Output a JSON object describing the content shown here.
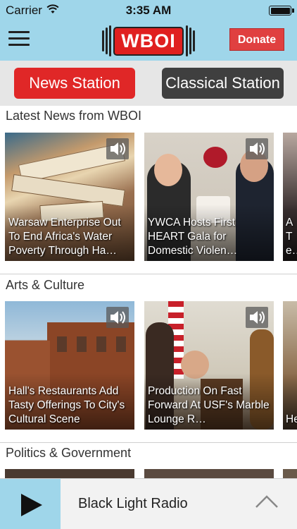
{
  "status": {
    "carrier": "Carrier",
    "time": "3:35 AM"
  },
  "header": {
    "logo_text": "WBOI",
    "donate_label": "Donate"
  },
  "stations": {
    "news_label": "News Station",
    "classical_label": "Classical Station"
  },
  "sections": [
    {
      "title": "Latest News from WBOI",
      "cards": [
        {
          "title": "Warsaw Enterprise Out To End Africa's Water Poverty Through Ha…"
        },
        {
          "title": "YWCA Hosts First HEART Gala for Domestic Violen…"
        },
        {
          "title": "A Te Sc"
        }
      ]
    },
    {
      "title": "Arts & Culture",
      "cards": [
        {
          "title": "Hall's Restaurants Add Tasty Offerings To City's Cultural Scene"
        },
        {
          "title": "Production On Fast Forward At USF's Marble Lounge R…"
        },
        {
          "title": "He"
        }
      ]
    },
    {
      "title": "Politics & Government"
    }
  ],
  "player": {
    "now_playing": "Black Light Radio"
  },
  "colors": {
    "header_bg": "#9fd6ea",
    "brand_red": "#e02020",
    "donate_red": "#e04040",
    "classical_dark": "#3f3f3f"
  }
}
